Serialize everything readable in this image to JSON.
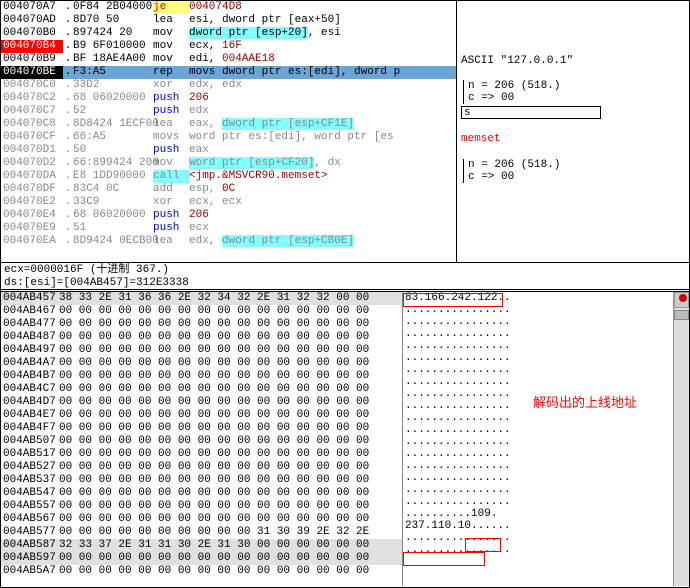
{
  "disasm": [
    {
      "addr": "004070A7",
      "dot": ".",
      "hex": "0F84 2B040000",
      "mnem": "je",
      "mnemCls": "hl-yel kw-red",
      "ops": "004074D8",
      "opsCls": "kw-dred"
    },
    {
      "addr": "004070AD",
      "dot": ".",
      "hex": "8D70 50",
      "mnem": "lea",
      "ops": "esi, dword ptr [eax+50]",
      "opsHl": ""
    },
    {
      "addr": "004070B0",
      "dot": ".",
      "hex": "897424 20",
      "mnem": "mov",
      "ops1": "dword ptr [esp+20]",
      "ops2": ", esi"
    },
    {
      "addr": "004070B4",
      "addrCls": "red-bg",
      "dot": ".",
      "hex": "B9 6F010000",
      "mnem": "mov",
      "ops": "ecx, ",
      "opsNum": "16F"
    },
    {
      "addr": "004070B9",
      "dot": ".",
      "hex": "BF 18AE4A00",
      "mnem": "mov",
      "ops": "edi, ",
      "opsNum": "004AAE18",
      "sideText": "ASCII \"127.0.0.1\""
    },
    {
      "addr": "004070BE",
      "addrCls": "black-bg",
      "rowCls": "sel",
      "dot": ".",
      "hex": "F3:A5",
      "mnem": "rep",
      "ops": "movs dword ptr es:[edi], dword p"
    },
    {
      "addr": "004070C0",
      "cls": "gray",
      "dot": ".",
      "hex": "33D2",
      "mnem": "xor",
      "ops": "edx, edx"
    },
    {
      "addr": "004070C2",
      "cls": "gray",
      "dot": ".",
      "hex": "68 06020000",
      "mnem": "push",
      "mnemCls": "kw-blue",
      "opsNum": "206"
    },
    {
      "addr": "004070C7",
      "cls": "gray",
      "dot": ".",
      "hex": "52",
      "mnem": "push",
      "mnemCls": "kw-blue",
      "ops": "edx"
    },
    {
      "addr": "004070C8",
      "cls": "gray",
      "dot": ".",
      "hex": "8D8424 1ECF00",
      "mnem": "lea",
      "ops": "eax, ",
      "opsHl": "dword ptr [esp+CF1E]"
    },
    {
      "addr": "004070CF",
      "cls": "gray",
      "dot": ".",
      "hex": "66:A5",
      "mnem": "movs",
      "ops": "word ptr es:[edi], word ptr [es"
    },
    {
      "addr": "004070D1",
      "cls": "gray",
      "dot": ".",
      "hex": "50",
      "mnem": "push",
      "mnemCls": "kw-blue",
      "ops": "eax"
    },
    {
      "addr": "004070D2",
      "cls": "gray",
      "dot": ".",
      "hex": "66:899424 200",
      "mnem": "mov",
      "opsHl": "word ptr [esp+CF20]",
      "ops2": ", dx"
    },
    {
      "addr": "004070DA",
      "cls": "gray",
      "dot": ".",
      "hex": "E8 1DD90000",
      "mnem": "call",
      "mnemCls": "hl-cyan",
      "ops": "<jmp.&MSVCR90.memset>",
      "opsCls": "kw-dred"
    },
    {
      "addr": "004070DF",
      "cls": "gray",
      "dot": ".",
      "hex": "83C4 0C",
      "mnem": "add",
      "ops": "esp, ",
      "opsNum": "0C"
    },
    {
      "addr": "004070E2",
      "cls": "gray",
      "dot": ".",
      "hex": "33C9",
      "mnem": "xor",
      "ops": "ecx, ecx"
    },
    {
      "addr": "004070E4",
      "cls": "gray",
      "dot": ".",
      "hex": "68 06020000",
      "mnem": "push",
      "mnemCls": "kw-blue",
      "opsNum": "206"
    },
    {
      "addr": "004070E9",
      "cls": "gray",
      "dot": ".",
      "hex": "51",
      "mnem": "push",
      "mnemCls": "kw-blue",
      "ops": "ecx"
    },
    {
      "addr": "004070EA",
      "cls": "gray",
      "dot": ".",
      "hex": "8D9424 0ECB00",
      "mnem": "lea",
      "ops": "edx, ",
      "opsHl": "dword ptr [esp+CB0E]"
    }
  ],
  "side": {
    "ascii": "ASCII \"127.0.0.1\"",
    "bracket1_n": "n = 206 (518.)",
    "bracket1_c": "c => 00",
    "s": "s",
    "memset": "memset",
    "bracket2_n": "n = 206 (518.)",
    "bracket2_c": "c => 00"
  },
  "info": {
    "line1": "ecx=0000016F (十进制 367.)",
    "line2": "ds:[esi]=[004AB457]=312E3338"
  },
  "hex": [
    {
      "addr": "004AB457",
      "addrCls": "hl-addr",
      "bytes": "38 33 2E 31 36 36 2E 32 34 32 2E 31 32 32 00 00",
      "ascii": "83.166.242.122.."
    },
    {
      "addr": "004AB467",
      "bytes": "00 00 00 00 00 00 00 00 00 00 00 00 00 00 00 00",
      "ascii": "................"
    },
    {
      "addr": "004AB477",
      "bytes": "00 00 00 00 00 00 00 00 00 00 00 00 00 00 00 00",
      "ascii": "................"
    },
    {
      "addr": "004AB487",
      "bytes": "00 00 00 00 00 00 00 00 00 00 00 00 00 00 00 00",
      "ascii": "................"
    },
    {
      "addr": "004AB497",
      "bytes": "00 00 00 00 00 00 00 00 00 00 00 00 00 00 00 00",
      "ascii": "................"
    },
    {
      "addr": "004AB4A7",
      "bytes": "00 00 00 00 00 00 00 00 00 00 00 00 00 00 00 00",
      "ascii": "................"
    },
    {
      "addr": "004AB4B7",
      "bytes": "00 00 00 00 00 00 00 00 00 00 00 00 00 00 00 00",
      "ascii": "................"
    },
    {
      "addr": "004AB4C7",
      "bytes": "00 00 00 00 00 00 00 00 00 00 00 00 00 00 00 00",
      "ascii": "................"
    },
    {
      "addr": "004AB4D7",
      "bytes": "00 00 00 00 00 00 00 00 00 00 00 00 00 00 00 00",
      "ascii": "................"
    },
    {
      "addr": "004AB4E7",
      "bytes": "00 00 00 00 00 00 00 00 00 00 00 00 00 00 00 00",
      "ascii": "................"
    },
    {
      "addr": "004AB4F7",
      "bytes": "00 00 00 00 00 00 00 00 00 00 00 00 00 00 00 00",
      "ascii": "................"
    },
    {
      "addr": "004AB507",
      "bytes": "00 00 00 00 00 00 00 00 00 00 00 00 00 00 00 00",
      "ascii": "................"
    },
    {
      "addr": "004AB517",
      "bytes": "00 00 00 00 00 00 00 00 00 00 00 00 00 00 00 00",
      "ascii": "................"
    },
    {
      "addr": "004AB527",
      "bytes": "00 00 00 00 00 00 00 00 00 00 00 00 00 00 00 00",
      "ascii": "................"
    },
    {
      "addr": "004AB537",
      "bytes": "00 00 00 00 00 00 00 00 00 00 00 00 00 00 00 00",
      "ascii": "................"
    },
    {
      "addr": "004AB547",
      "bytes": "00 00 00 00 00 00 00 00 00 00 00 00 00 00 00 00",
      "ascii": "................"
    },
    {
      "addr": "004AB557",
      "bytes": "00 00 00 00 00 00 00 00 00 00 00 00 00 00 00 00",
      "ascii": "................"
    },
    {
      "addr": "004AB567",
      "bytes": "00 00 00 00 00 00 00 00 00 00 00 00 00 00 00 00",
      "ascii": "................"
    },
    {
      "addr": "004AB577",
      "bytes": "00 00 00 00 00 00 00 00 00 00 31 30 39 2E 32 2E",
      "ascii": "..........109."
    },
    {
      "addr": "004AB587",
      "addrCls": "hl-addr",
      "bytes": "32 33 37 2E 31 31 30 2E 31 30 00 00 00 00 00 00",
      "ascii": "237.110.10......"
    },
    {
      "addr": "004AB597",
      "addrCls": "hl-addr",
      "bytes": "00 00 00 00 00 00 00 00 00 00 00 00 00 00 00 00",
      "ascii": "................"
    },
    {
      "addr": "004AB5A7",
      "bytes": "00 00 00 00 00 00 00 00 00 00 00 00 00 00 00 00",
      "ascii": "................"
    }
  ],
  "annotation": "解码出的上线地址"
}
